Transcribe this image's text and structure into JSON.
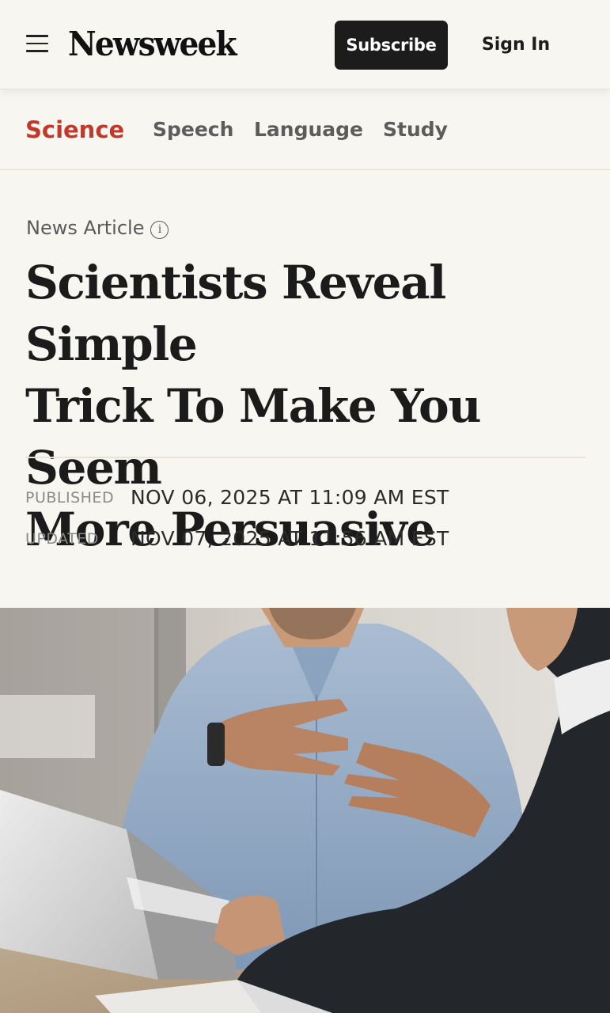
{
  "header": {
    "logo_text": "Newsweek",
    "subscribe_label": "Subscribe",
    "signin_label": "Sign In"
  },
  "topics": [
    {
      "label": "Science",
      "active": true
    },
    {
      "label": "Speech",
      "active": false
    },
    {
      "label": "Language",
      "active": false
    },
    {
      "label": "Study",
      "active": false
    }
  ],
  "article": {
    "type_label": "News Article",
    "headline_lines": [
      "Scientists Reveal Simple",
      "Trick To Make You Seem",
      "More Persuasive"
    ],
    "published_label": "PUBLISHED",
    "published_value": "NOV 06, 2025 AT 11:09 AM EST",
    "updated_label": "UPDATED",
    "updated_value": "NOV 07, 2025 AT 11:56 AM EST"
  },
  "colors": {
    "accent": "#c0392b",
    "background": "#f8f6f1",
    "button": "#1c1c1c"
  },
  "icons": {
    "menu": "hamburger-menu-icon",
    "info": "info-icon"
  }
}
